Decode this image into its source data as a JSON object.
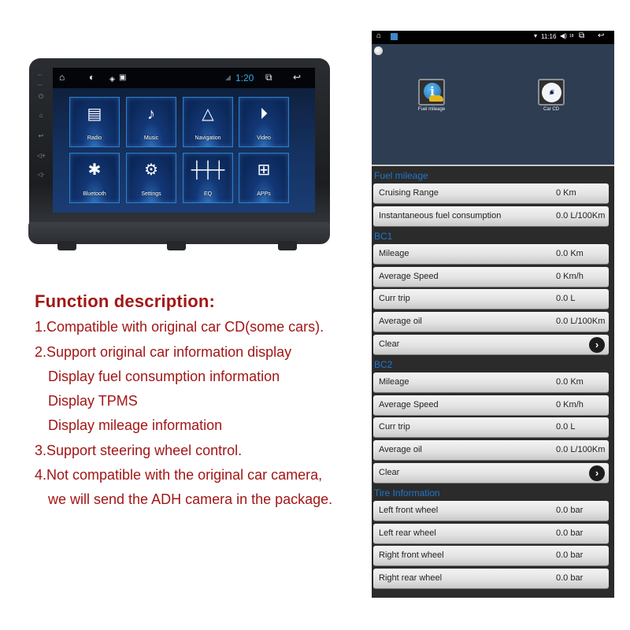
{
  "head_unit": {
    "status_bar": {
      "home_icon": "home-outline-icon",
      "brightness_icon": "brightness-icon",
      "gps_icon": "gps-icon",
      "gallery_icon": "image-icon",
      "signal_icon": "signal-icon",
      "time": "1:20",
      "recents_icon": "recent-apps-icon",
      "back_icon": "back-arrow-icon"
    },
    "bezel_buttons": [
      {
        "label": "MIC",
        "icon": "mic-label"
      },
      {
        "label": "RST",
        "icon": "reset-label"
      },
      {
        "label": "",
        "icon": "power-icon"
      },
      {
        "label": "",
        "icon": "home-icon"
      },
      {
        "label": "",
        "icon": "back-icon"
      },
      {
        "label": "",
        "icon": "volume-up-icon"
      },
      {
        "label": "",
        "icon": "volume-down-icon"
      }
    ],
    "tiles": [
      {
        "label": "Radio",
        "icon": "radio-icon",
        "glyph": "📻"
      },
      {
        "label": "Music",
        "icon": "music-note-icon",
        "glyph": "♪"
      },
      {
        "label": "Navigation",
        "icon": "navigation-arrow-icon",
        "glyph": "△"
      },
      {
        "label": "Video",
        "icon": "play-circle-icon",
        "glyph": "▶"
      },
      {
        "label": "Bluetooth",
        "icon": "bluetooth-icon",
        "glyph": "ᛒ"
      },
      {
        "label": "Settings",
        "icon": "gear-icon",
        "glyph": "⚙"
      },
      {
        "label": "EQ",
        "icon": "equalizer-icon",
        "glyph": "⫶"
      },
      {
        "label": "APPs",
        "icon": "app-grid-icon",
        "glyph": "▦"
      }
    ]
  },
  "description": {
    "title": "Function description:",
    "lines": [
      "1.Compatible with original car CD(some cars).",
      "2.Support original car  information display",
      "Display fuel consumption information",
      "Display TPMS",
      "Display mileage information",
      "3.Support steering wheel control.",
      "4.Not compatible with the original car camera,",
      "we will send the ADH camera in the package."
    ]
  },
  "car_info_screen": {
    "status_bar": {
      "time": "11:16",
      "volume_level": "18",
      "wifi_icon": "wifi-icon",
      "volume_icon": "volume-icon",
      "recents_icon": "recent-apps-icon",
      "back_icon": "back-arrow-icon"
    },
    "apps": [
      {
        "label": "Fuel mileage",
        "icon": "fuel-mileage-info-icon"
      },
      {
        "label": "Car CD",
        "icon": "car-cd-icon"
      }
    ],
    "sections": [
      {
        "title": "Fuel mileage",
        "rows": [
          {
            "label": "Cruising Range",
            "value": "0 Km"
          },
          {
            "label": "Instantaneous fuel consumption",
            "value": "0.0 L/100Km"
          }
        ]
      },
      {
        "title": "BC1",
        "rows": [
          {
            "label": "Mileage",
            "value": "0.0 Km"
          },
          {
            "label": "Average Speed",
            "value": "0 Km/h"
          },
          {
            "label": "Curr trip",
            "value": "0.0 L"
          },
          {
            "label": "Average oil",
            "value": "0.0 L/100Km"
          },
          {
            "label": "Clear",
            "value": ""
          }
        ]
      },
      {
        "title": "BC2",
        "rows": [
          {
            "label": "Mileage",
            "value": "0.0 Km"
          },
          {
            "label": "Average Speed",
            "value": "0 Km/h"
          },
          {
            "label": "Curr trip",
            "value": "0.0 L"
          },
          {
            "label": "Average oil",
            "value": "0.0 L/100Km"
          },
          {
            "label": "Clear",
            "value": ""
          }
        ]
      },
      {
        "title": "Tire Information",
        "rows": [
          {
            "label": "Left front wheel",
            "value": "0.0 bar"
          },
          {
            "label": "Left rear wheel",
            "value": "0.0 bar"
          },
          {
            "label": "Right front wheel",
            "value": "0.0 bar"
          },
          {
            "label": "Right rear wheel",
            "value": "0.0 bar"
          }
        ]
      }
    ]
  },
  "colors": {
    "description_text": "#a31616",
    "section_header": "#1f78d0",
    "clock_accent": "#39a7e6"
  }
}
